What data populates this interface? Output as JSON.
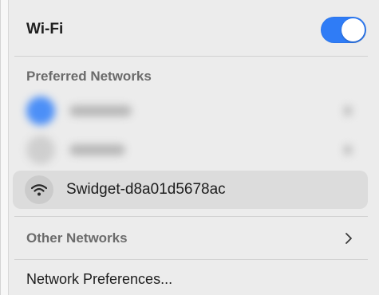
{
  "header": {
    "title": "Wi-Fi",
    "toggle_on": true,
    "accent_color": "#2f7cf6"
  },
  "preferred": {
    "label": "Preferred Networks",
    "current": {
      "name": "Swidget-d8a01d5678ac",
      "icon": "wifi-icon"
    }
  },
  "other": {
    "label": "Other Networks",
    "icon": "chevron-right-icon"
  },
  "footer": {
    "label": "Network Preferences..."
  }
}
